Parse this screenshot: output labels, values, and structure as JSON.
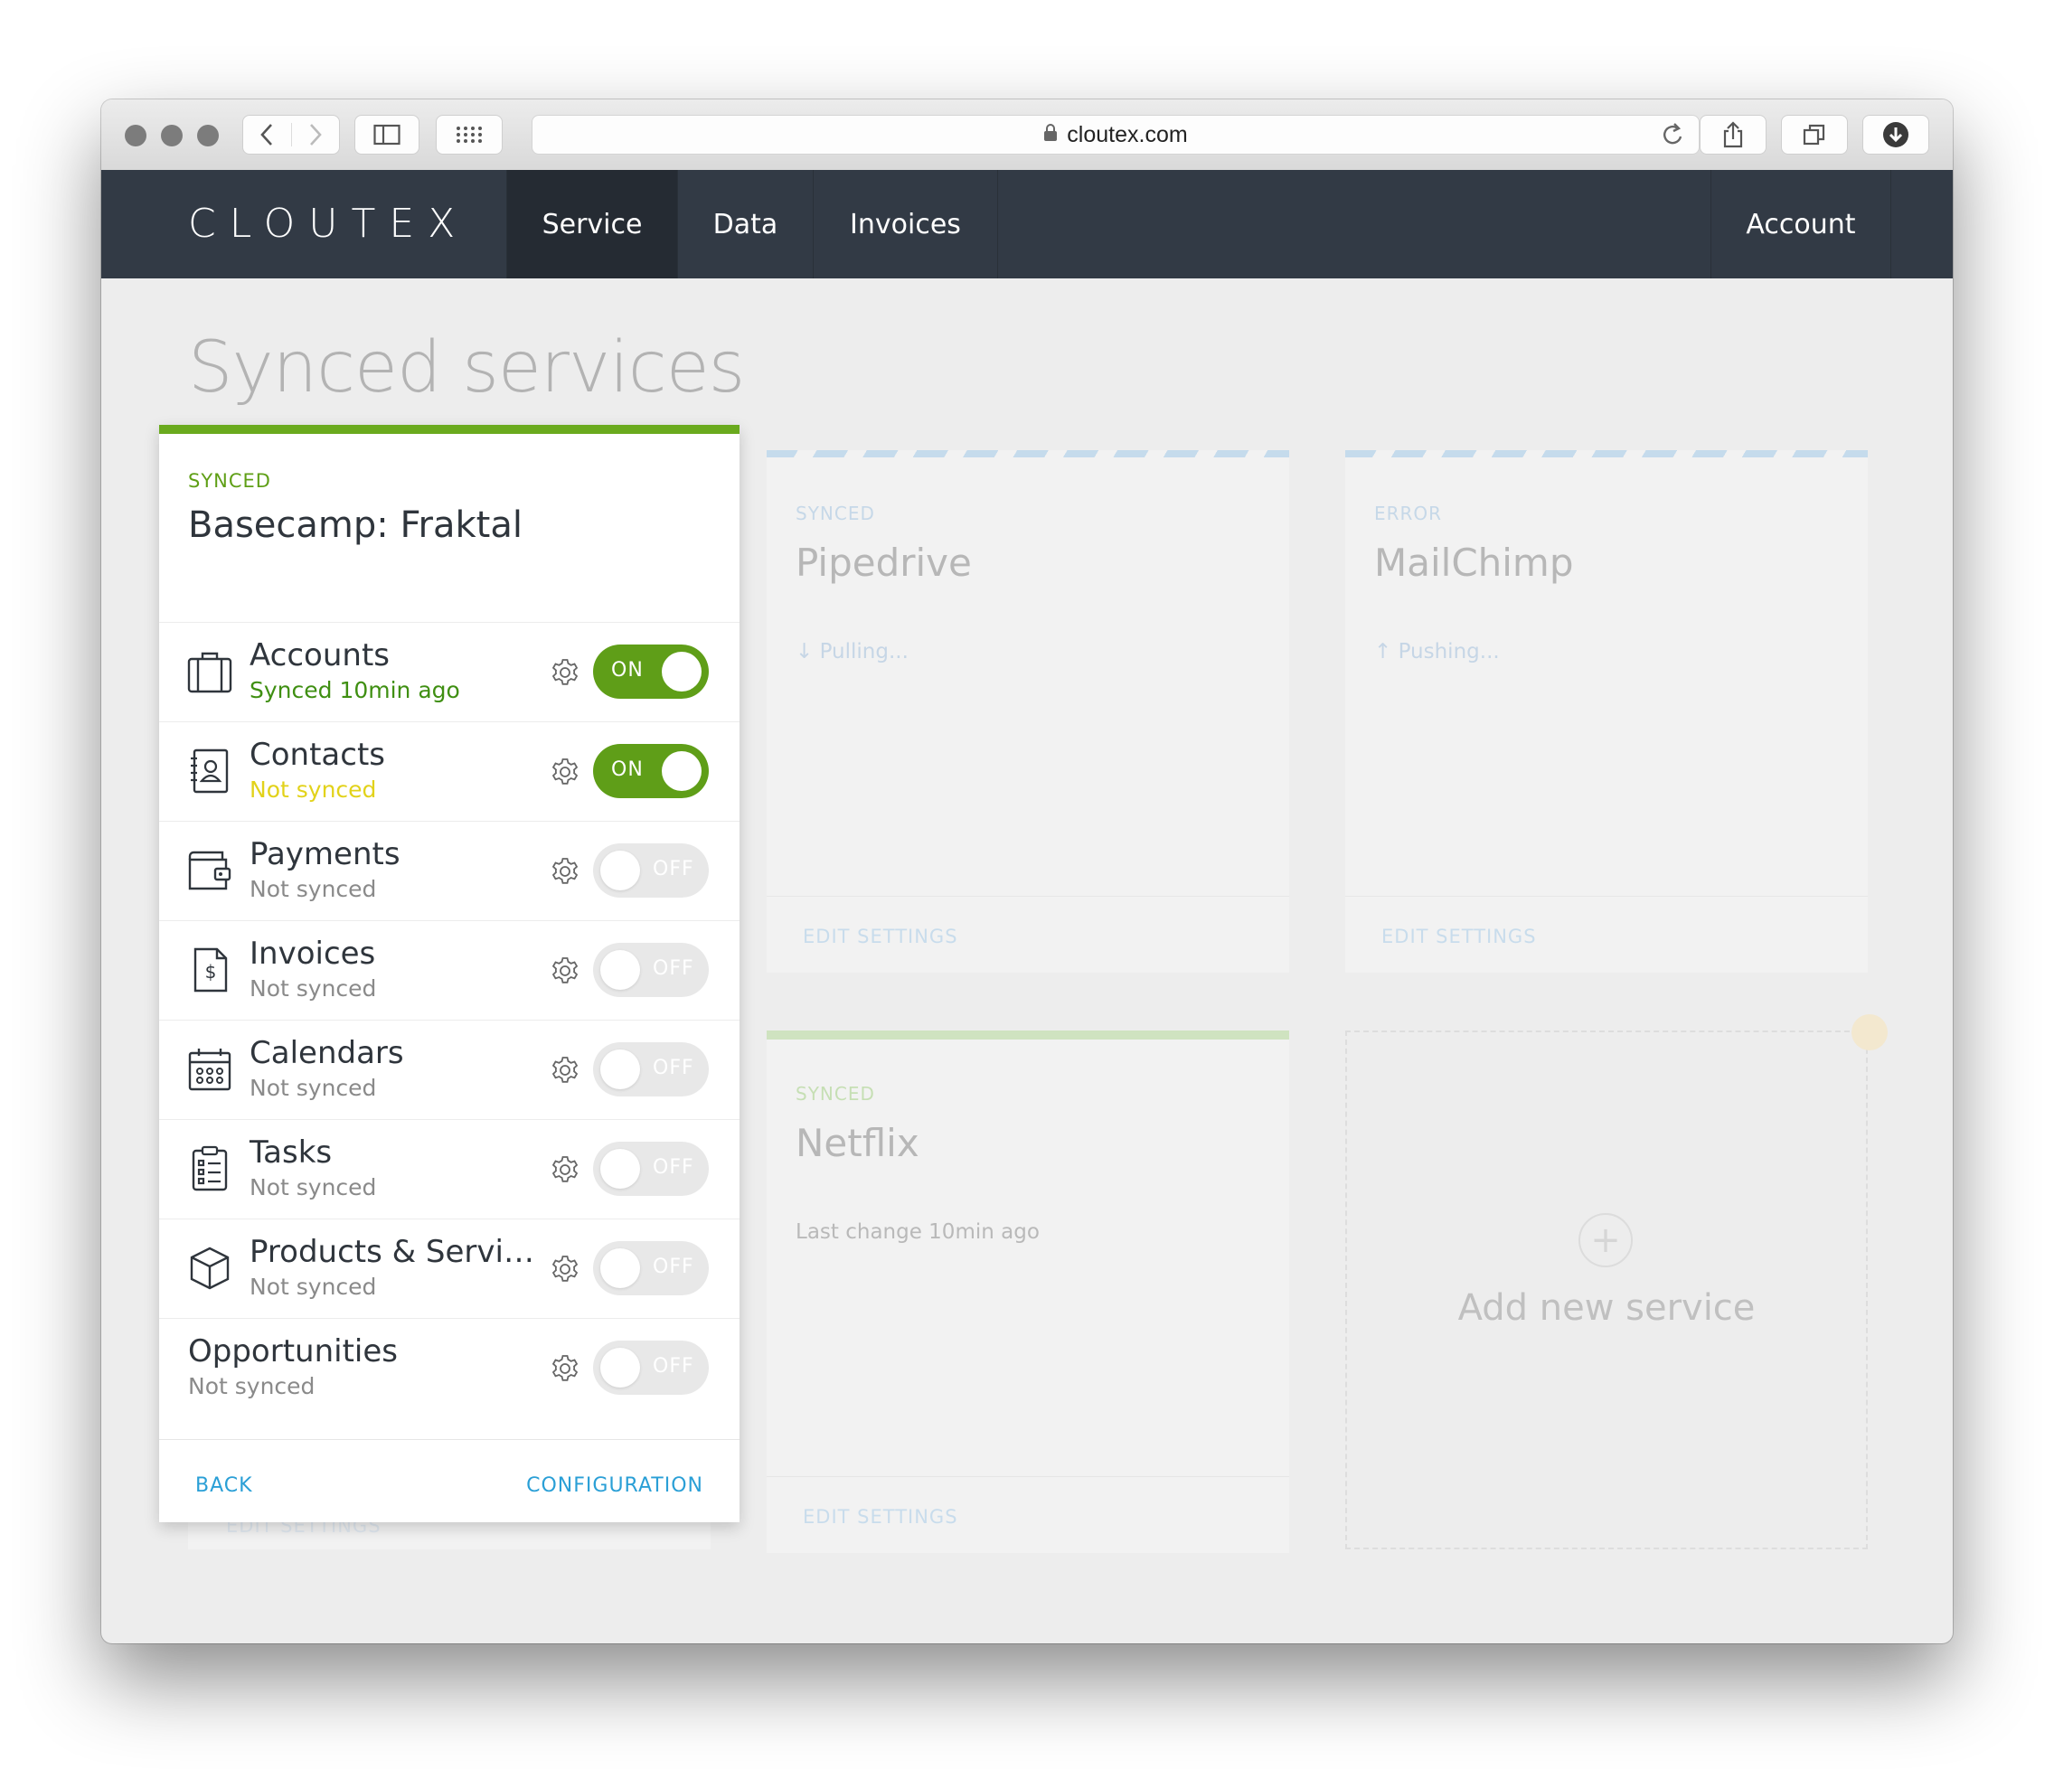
{
  "browser": {
    "url": "cloutex.com"
  },
  "nav": {
    "logo": "CLOUTEX",
    "items": [
      {
        "label": "Service",
        "active": true
      },
      {
        "label": "Data",
        "active": false
      },
      {
        "label": "Invoices",
        "active": false
      }
    ],
    "account_label": "Account"
  },
  "page": {
    "title": "Synced services"
  },
  "active_service": {
    "status": "SYNCED",
    "title": "Basecamp: Fraktal",
    "rows": [
      {
        "name": "Accounts",
        "status": "Synced 10min ago",
        "status_color": "#3f8f12",
        "toggle": "ON",
        "icon": "briefcase-icon"
      },
      {
        "name": "Contacts",
        "status": "Not synced",
        "status_color": "#e2d21a",
        "toggle": "ON",
        "icon": "contact-book-icon"
      },
      {
        "name": "Payments",
        "status": "Not synced",
        "status_color": "#8a8a8a",
        "toggle": "OFF",
        "icon": "wallet-icon"
      },
      {
        "name": "Invoices",
        "status": "Not synced",
        "status_color": "#8a8a8a",
        "toggle": "OFF",
        "icon": "invoice-icon"
      },
      {
        "name": "Calendars",
        "status": "Not synced",
        "status_color": "#8a8a8a",
        "toggle": "OFF",
        "icon": "calendar-icon"
      },
      {
        "name": "Tasks",
        "status": "Not synced",
        "status_color": "#8a8a8a",
        "toggle": "OFF",
        "icon": "task-list-icon"
      },
      {
        "name": "Products & Servi…",
        "status": "Not synced",
        "status_color": "#8a8a8a",
        "toggle": "OFF",
        "icon": "product-box-icon"
      },
      {
        "name": "Opportunities",
        "status": "Not synced",
        "status_color": "#8a8a8a",
        "toggle": "OFF",
        "icon": ""
      }
    ],
    "back_label": "BACK",
    "config_label": "CONFIGURATION"
  },
  "service_cards": [
    {
      "status": "SYNCED",
      "status_color": "#c6d8e8",
      "name": "Pipedrive",
      "info": "↓ Pulling...",
      "edit_label": "EDIT SETTINGS"
    },
    {
      "status": "ERROR",
      "status_color": "#c6d8e8",
      "name": "MailChimp",
      "info": "↑ Pushing...",
      "edit_label": "EDIT SETTINGS"
    },
    {
      "status": "SYNCED",
      "status_color": "#c6dfb4",
      "name": "Netflix",
      "info": "Last change 10min ago",
      "edit_label": "EDIT SETTINGS"
    }
  ],
  "hidden_card_edit_label": "EDIT SETTINGS",
  "add_service_label": "Add new service",
  "colors": {
    "nav_bg": "#323a45",
    "nav_active_bg": "#252b33",
    "accent_green": "#5f9e18",
    "link_blue": "#2a9fd6"
  }
}
